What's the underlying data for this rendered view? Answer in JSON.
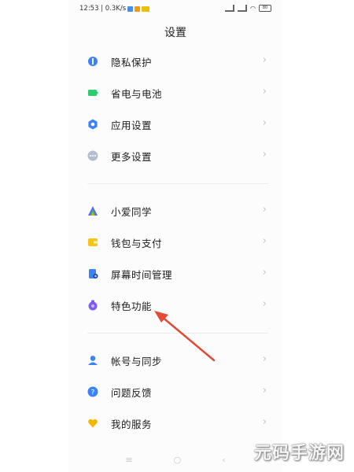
{
  "status_bar": {
    "time_speed": "12:53 | 0.3K/s",
    "battery": "80"
  },
  "page_title": "设置",
  "groups": [
    {
      "items": [
        {
          "label": "隐私保护",
          "icon": "privacy-shield-icon",
          "color": "#3b82f6"
        },
        {
          "label": "省电与电池",
          "icon": "battery-icon",
          "color": "#2ecc71"
        },
        {
          "label": "应用设置",
          "icon": "gear-icon",
          "color": "#3b82f6"
        },
        {
          "label": "更多设置",
          "icon": "more-dots-icon",
          "color": "#94a3b8"
        }
      ]
    },
    {
      "items": [
        {
          "label": "小爱同学",
          "icon": "xiaoai-icon",
          "color": "#6366f1"
        },
        {
          "label": "钱包与支付",
          "icon": "wallet-icon",
          "color": "#f5c518"
        },
        {
          "label": "屏幕时间管理",
          "icon": "screen-time-icon",
          "color": "#3b82f6"
        },
        {
          "label": "特色功能",
          "icon": "features-icon",
          "color": "#7c5cf2"
        }
      ]
    },
    {
      "items": [
        {
          "label": "帐号与同步",
          "icon": "account-icon",
          "color": "#3b82f6"
        },
        {
          "label": "问题反馈",
          "icon": "feedback-icon",
          "color": "#3b82f6"
        },
        {
          "label": "我的服务",
          "icon": "heart-service-icon",
          "color": "#f5b800"
        }
      ]
    }
  ],
  "chevron": "›",
  "nav": {
    "menu": "≡",
    "home": "○",
    "back": "‹"
  },
  "watermark": "元码手游网",
  "annotation_color": "#e04a36"
}
